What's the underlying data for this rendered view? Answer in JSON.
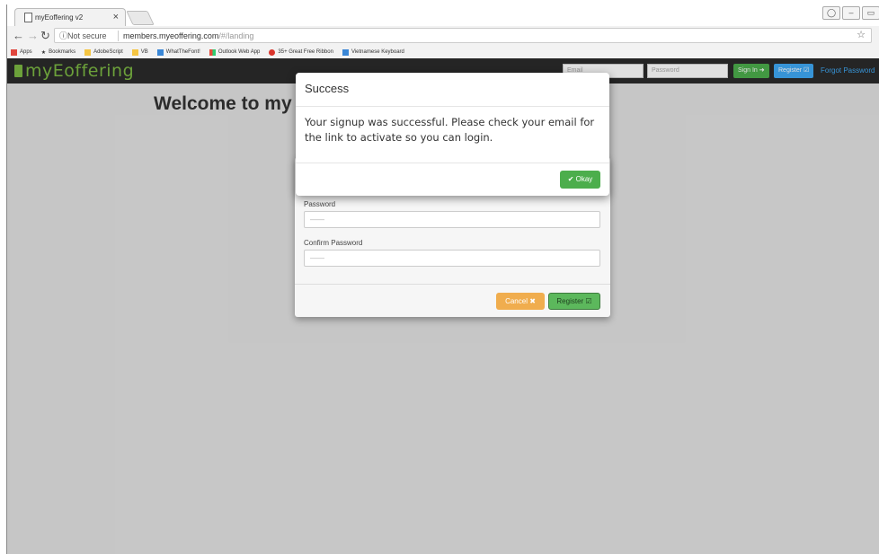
{
  "browser": {
    "tab_title": "myEoffering v2",
    "tab_close": "×",
    "url_security": "Not secure",
    "url_host": "members.myeoffering.com",
    "url_path": "/#/landing",
    "bookmarks": [
      "Apps",
      "Bookmarks",
      "AdobeScript",
      "VB",
      "WhatTheFont!",
      "Outlook Web App",
      "35+ Great Free Ribbon",
      "Vietnamese Keyboard"
    ]
  },
  "site": {
    "brand": "myEoffering",
    "email_placeholder": "Email",
    "password_placeholder": "Password",
    "signin_label": "Sign In ➜",
    "register_label": "Register ☑",
    "forgot_label": "Forgot Password",
    "welcome_text": "Welcome to my",
    "colors": {
      "brand_green": "#7bb843",
      "navbar": "#2b2b2b",
      "link_blue": "#3fa9f5",
      "okay_green": "#4cae4c",
      "cancel_orange": "#f0ad4e"
    }
  },
  "register_modal": {
    "password_label": "Password",
    "password_value": "——",
    "confirm_label": "Confirm Password",
    "confirm_value": "——",
    "cancel_label": "Cancel ✖",
    "register_label": "Register ☑"
  },
  "success_modal": {
    "title": "Success",
    "message": "Your signup was successful. Please check your email for the link to activate so you can login.",
    "okay_label": "✔ Okay"
  }
}
